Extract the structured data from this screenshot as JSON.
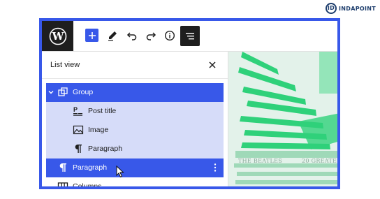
{
  "brand": {
    "name": "INDAPOINT",
    "mark": "ID",
    "logo_color": "#1f3f6e"
  },
  "colors": {
    "accent": "#3858e9",
    "dark": "#1e1e1e",
    "selected_child": "#d6dcf9",
    "hero_green": "#2fd17a"
  },
  "toolbar": {
    "logo": "wordpress-icon",
    "buttons": [
      {
        "name": "add-block-button",
        "icon": "plus-icon"
      },
      {
        "name": "tools-button",
        "icon": "pencil-icon"
      },
      {
        "name": "undo-button",
        "icon": "undo-icon"
      },
      {
        "name": "redo-button",
        "icon": "redo-icon"
      },
      {
        "name": "details-button",
        "icon": "info-icon"
      },
      {
        "name": "list-view-button",
        "icon": "list-view-icon",
        "active": true
      }
    ]
  },
  "list_view": {
    "title": "List view",
    "close_icon": "close-icon",
    "items": [
      {
        "label": "Group",
        "icon": "group-icon",
        "expanded": true,
        "selected": true,
        "level": 1
      },
      {
        "label": "Post title",
        "icon": "post-title-icon",
        "level": 2
      },
      {
        "label": "Image",
        "icon": "image-icon",
        "level": 2
      },
      {
        "label": "Paragraph",
        "icon": "paragraph-icon",
        "level": 2
      },
      {
        "label": "Paragraph",
        "icon": "paragraph-icon",
        "selected": true,
        "level": 1,
        "has_options": true
      },
      {
        "label": "Columns",
        "icon": "columns-icon",
        "level": 1
      }
    ]
  },
  "hero": {
    "caption_left": "THE BEATLES",
    "caption_right": "20 GREATE"
  }
}
